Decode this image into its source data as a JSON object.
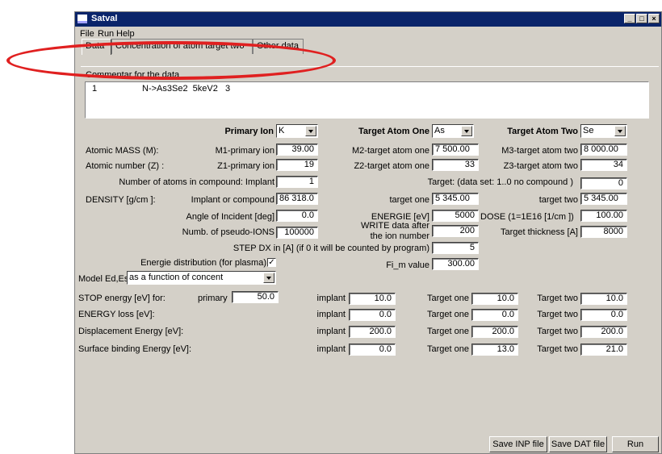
{
  "window": {
    "title": "Satval"
  },
  "menu": [
    "File",
    "Run",
    "Help"
  ],
  "tabs": [
    "Data",
    "Concentration of atom target two",
    "Other data"
  ],
  "commentary": {
    "label": "Commentar for the data",
    "line_number": "1",
    "text": "N->As3Se2  5keV2   3"
  },
  "headers": {
    "primary_ion": "Primary Ion",
    "target_one": "Target Atom One",
    "target_two": "Target Atom Two"
  },
  "selects": {
    "primary_ion": "K",
    "target_one": "As",
    "target_two": "Se"
  },
  "rows": {
    "atomic_mass": {
      "label": "Atomic MASS (M):",
      "l1": "M1-primary ion",
      "v1": "39.00",
      "l2": "M2-target atom one",
      "v2": "7 500.00",
      "l3": "M3-target atom two",
      "v3": "8 000.00"
    },
    "atomic_number": {
      "label": "Atomic number (Z) :",
      "l1": "Z1-primary ion",
      "v1": "19",
      "l2": "Z2-target atom one",
      "v2": "33",
      "l3": "Z3-target atom two",
      "v3": "34"
    },
    "num_atoms": {
      "label": "Number of atoms in compound:  Implant",
      "v1": "1",
      "l2": "Target: (data set: 1..0 no compound )",
      "v3": "0"
    },
    "density": {
      "label": "DENSITY [g/cm  ]:",
      "l1": "Implant or compound",
      "v1": "86 318.0",
      "l2": "target one",
      "v2": "5 345.00",
      "l3": "target two",
      "v3": "5 345.00"
    },
    "angle": {
      "l1": "Angle of Incident [deg]",
      "v1": "0.0",
      "l2": "ENERGIE [eV]",
      "v2": "5000",
      "l3": "DOSE (1=1E16 [1/cm  ])",
      "v3": "100.00"
    },
    "pseudo": {
      "l1": "Numb. of pseudo-IONS",
      "v1": "100000",
      "l2a": "WRITE data after",
      "l2b": "the ion number",
      "v2": "200",
      "l3": "Target thickness [A]",
      "v3": "8000"
    },
    "step": {
      "label": "STEP DX in [A] (if 0 it will be counted by program)",
      "value": "5"
    },
    "energie_dist": {
      "label": "Energie distribution (for plasma)",
      "checked": "✓",
      "fi_label": "Fi_m value",
      "fi_value": "300.00"
    }
  },
  "model": {
    "label": "Model Ed,Es",
    "value": "as a function of concent"
  },
  "energy_table": {
    "col_implant": "implant",
    "col_one": "Target one",
    "col_two": "Target two",
    "stop": {
      "label": "STOP energy [eV] for:",
      "primary_label": "primary",
      "primary": "50.0",
      "implant": "10.0",
      "one": "10.0",
      "two": "10.0"
    },
    "loss": {
      "label": "ENERGY loss [eV]:",
      "implant": "0.0",
      "one": "0.0",
      "two": "0.0"
    },
    "displacement": {
      "label": "Displacement Energy [eV]:",
      "implant": "200.0",
      "one": "200.0",
      "two": "200.0"
    },
    "surface": {
      "label": "Surface binding Energy [eV]:",
      "implant": "0.0",
      "one": "13.0",
      "two": "21.0"
    }
  },
  "buttons": {
    "save_inp": "Save INP file",
    "save_dat": "Save DAT file",
    "run": "Run"
  },
  "colors": {
    "titlebar": "#0a246a",
    "window": "#d4d0c8",
    "annotation": "#e02020"
  }
}
